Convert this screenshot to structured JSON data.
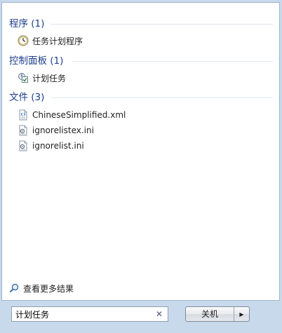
{
  "sections": {
    "programs": {
      "title": "程序 (1)",
      "items": [
        {
          "label": "任务计划程序",
          "icon": "clock-icon"
        }
      ]
    },
    "control_panel": {
      "title": "控制面板 (1)",
      "items": [
        {
          "label": "计划任务",
          "icon": "scheduled-task-icon"
        }
      ]
    },
    "files": {
      "title": "文件 (3)",
      "items": [
        {
          "label": "ChineseSimplified.xml",
          "icon": "xml-file-icon"
        },
        {
          "label": "ignorelistex.ini",
          "icon": "ini-file-icon"
        },
        {
          "label": "ignorelist.ini",
          "icon": "ini-file-icon"
        }
      ]
    }
  },
  "see_more": {
    "label": "查看更多结果",
    "icon": "search-icon"
  },
  "search": {
    "value": "计划任务",
    "clear_icon": "close-icon"
  },
  "shutdown": {
    "label": "关机",
    "arrow_icon": "chevron-right-icon"
  },
  "colors": {
    "section_title": "#1e3f8c",
    "divider": "#dfe5ec",
    "frame": "#c9d9ec"
  }
}
